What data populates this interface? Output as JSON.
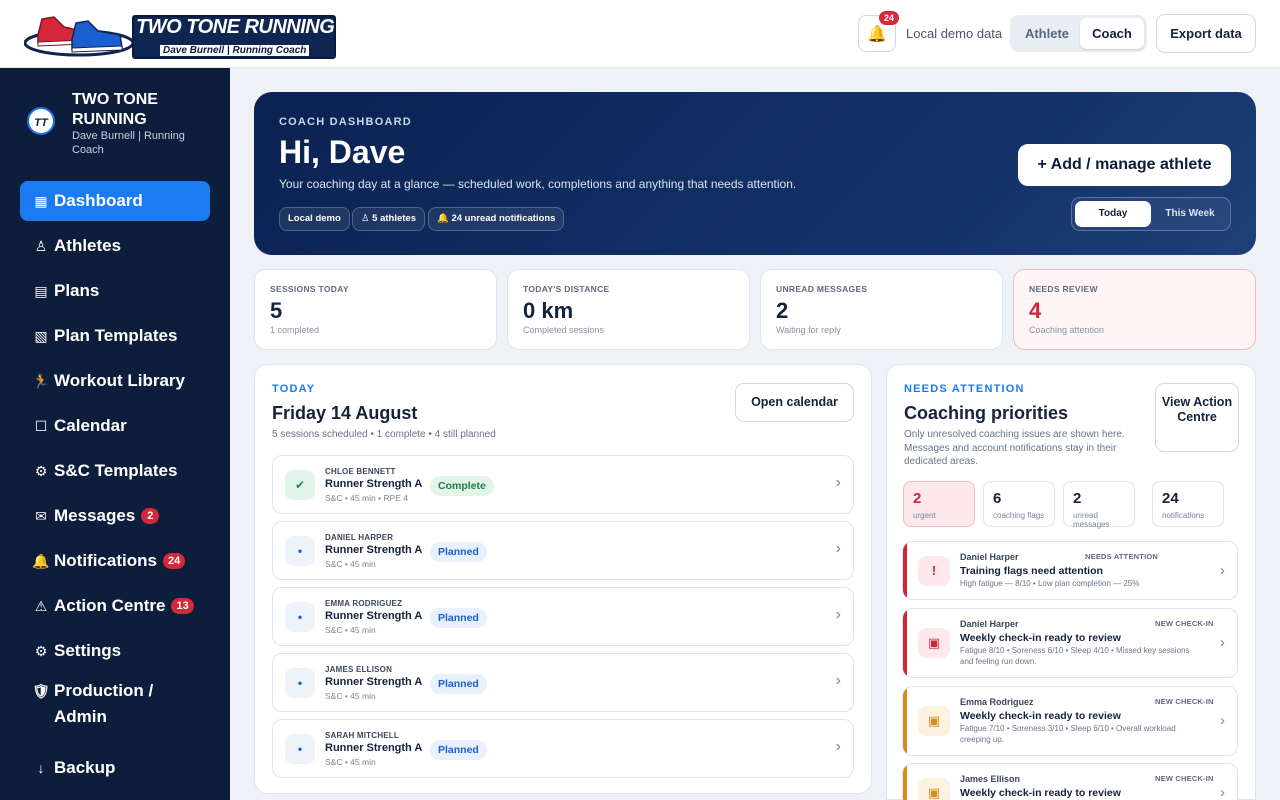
{
  "header": {
    "logo_title": "TWO TONE RUNNING",
    "logo_subtitle": "Dave Burnell | Running Coach",
    "notification_count": "24",
    "demo_label": "Local demo data",
    "roles": [
      "Athlete",
      "Coach"
    ],
    "active_role": "Coach",
    "export_label": "Export data"
  },
  "sidebar": {
    "brand_initials": "TT",
    "brand_name": "TWO TONE RUNNING",
    "brand_sub": "Dave Burnell | Running Coach",
    "items": [
      {
        "icon": "▦",
        "label": "Dashboard",
        "badge": ""
      },
      {
        "icon": "♙",
        "label": "Athletes",
        "badge": ""
      },
      {
        "icon": "▤",
        "label": "Plans",
        "badge": ""
      },
      {
        "icon": "▧",
        "label": "Plan Templates",
        "badge": ""
      },
      {
        "icon": "🏃",
        "label": "Workout Library",
        "badge": ""
      },
      {
        "icon": "☐",
        "label": "Calendar",
        "badge": ""
      },
      {
        "icon": "⚙",
        "label": "S&C Templates",
        "badge": ""
      },
      {
        "icon": "✉",
        "label": "Messages",
        "badge": "2"
      },
      {
        "icon": "🔔",
        "label": "Notifications",
        "badge": "24"
      },
      {
        "icon": "⚠",
        "label": "Action Centre",
        "badge": "13"
      },
      {
        "icon": "⚙",
        "label": "Settings",
        "badge": ""
      },
      {
        "icon": "🛡",
        "label": "Production / Admin",
        "badge": ""
      },
      {
        "icon": "↓",
        "label": "Backup",
        "badge": ""
      }
    ]
  },
  "hero": {
    "kicker": "COACH DASHBOARD",
    "title": "Hi, Dave",
    "text": "Your coaching day at a glance — scheduled work, completions and anything that needs attention.",
    "chips": [
      "Local demo",
      "♙ 5 athletes",
      "🔔 24 unread notifications"
    ],
    "add_button": "+ Add / manage athlete",
    "periods": [
      "Today",
      "This Week"
    ]
  },
  "stats": [
    {
      "label": "SESSIONS TODAY",
      "value": "5",
      "note": "1 completed"
    },
    {
      "label": "TODAY'S DISTANCE",
      "value": "0 km",
      "note": "Completed sessions"
    },
    {
      "label": "UNREAD MESSAGES",
      "value": "2",
      "note": "Waiting for reply"
    },
    {
      "label": "NEEDS REVIEW",
      "value": "4",
      "note": "Coaching attention"
    }
  ],
  "today": {
    "kicker": "TODAY",
    "title": "Friday 14 August",
    "subtitle": "5 sessions scheduled • 1 complete • 4 still planned",
    "calendar_button": "Open calendar",
    "sessions": [
      {
        "athlete": "CHLOE BENNETT",
        "title": "Runner Strength A",
        "meta": "S&C • 45 min • RPE 4",
        "status": "Complete",
        "icon": "✔"
      },
      {
        "athlete": "DANIEL HARPER",
        "title": "Runner Strength A",
        "meta": "S&C • 45 min",
        "status": "Planned",
        "icon": "•"
      },
      {
        "athlete": "EMMA RODRIGUEZ",
        "title": "Runner Strength A",
        "meta": "S&C • 45 min",
        "status": "Planned",
        "icon": "•"
      },
      {
        "athlete": "JAMES ELLISON",
        "title": "Runner Strength A",
        "meta": "S&C • 45 min",
        "status": "Planned",
        "icon": "•"
      },
      {
        "athlete": "SARAH MITCHELL",
        "title": "Runner Strength A",
        "meta": "S&C • 45 min",
        "status": "Planned",
        "icon": "•"
      }
    ]
  },
  "attention": {
    "kicker": "NEEDS ATTENTION",
    "title": "Coaching priorities",
    "subtitle": "Only unresolved coaching issues are shown here. Messages and account notifications stay in their dedicated areas.",
    "action_button": "View Action Centre",
    "counts": [
      {
        "value": "2",
        "label": "urgent"
      },
      {
        "value": "6",
        "label": "coaching flags"
      },
      {
        "value": "2",
        "label": "unread messages"
      },
      {
        "value": "24",
        "label": "notifications"
      }
    ],
    "flags": [
      {
        "athlete": "Daniel Harper",
        "tag": "NEEDS ATTENTION",
        "title": "Training flags need attention",
        "meta": "High fatigue — 8/10 • Low plan completion — 25%",
        "icon": "!",
        "color": "#c9283b"
      },
      {
        "athlete": "Daniel Harper",
        "tag": "NEW CHECK-IN",
        "title": "Weekly check-in ready to review",
        "meta": "Fatigue 8/10 • Soreness 6/10 • Sleep 4/10 • Missed key sessions and feeling run down.",
        "icon": "▣",
        "color": "#c9283b"
      },
      {
        "athlete": "Emma Rodriguez",
        "tag": "NEW CHECK-IN",
        "title": "Weekly check-in ready to review",
        "meta": "Fatigue 7/10 • Soreness 3/10 • Sleep 6/10 • Overall workload creeping up.",
        "icon": "▣",
        "color": "#d98a1c"
      },
      {
        "athlete": "James Ellison",
        "tag": "NEW CHECK-IN",
        "title": "Weekly check-in ready to review",
        "meta": "",
        "icon": "▣",
        "color": "#d98a1c"
      }
    ]
  }
}
